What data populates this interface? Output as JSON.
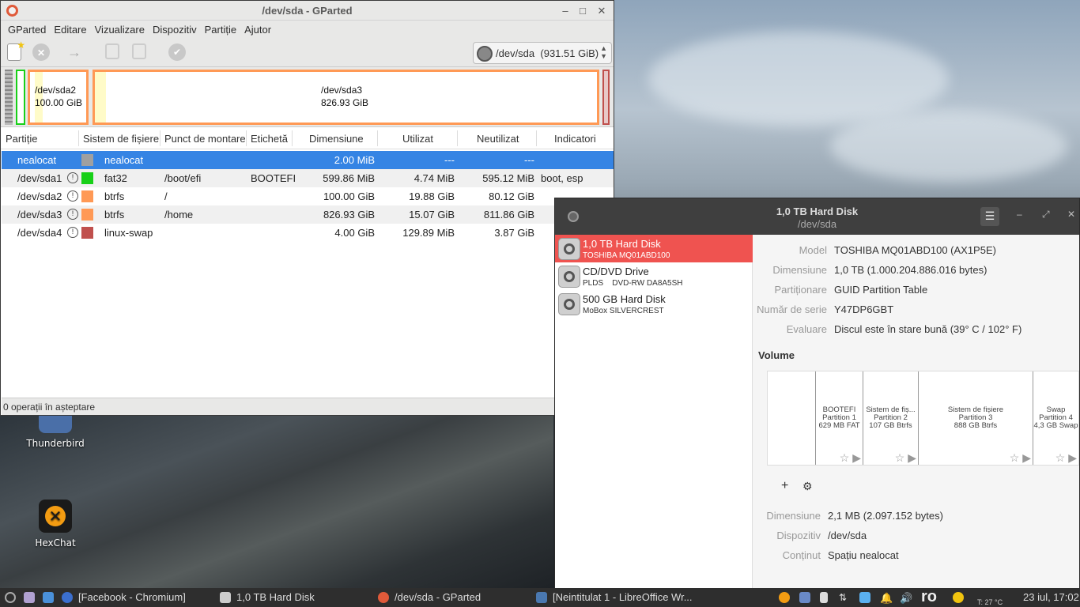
{
  "gparted": {
    "title": "/dev/sda - GParted",
    "menu": [
      "GParted",
      "Editare",
      "Vizualizare",
      "Dispozitiv",
      "Partiție",
      "Ajutor"
    ],
    "device_select": {
      "name": "/dev/sda",
      "size": "(931.51 GiB)"
    },
    "map": {
      "sda2_name": "/dev/sda2",
      "sda2_size": "100.00 GiB",
      "sda3_name": "/dev/sda3",
      "sda3_size": "826.93 GiB"
    },
    "columns": [
      "Partiție",
      "Sistem de fișiere",
      "Punct de montare",
      "Etichetă",
      "Dimensiune",
      "Utilizat",
      "Neutilizat",
      "Indicatori"
    ],
    "rows": [
      {
        "part": "nealocat",
        "fs": "nealocat",
        "mount": "",
        "label": "",
        "size": "2.00 MiB",
        "used": "---",
        "unused": "---",
        "flags": "",
        "color": "#a0a0a0"
      },
      {
        "part": "/dev/sda1",
        "fs": "fat32",
        "mount": "/boot/efi",
        "label": "BOOTEFI",
        "size": "599.86 MiB",
        "used": "4.74 MiB",
        "unused": "595.12 MiB",
        "flags": "boot, esp",
        "color": "#18d018"
      },
      {
        "part": "/dev/sda2",
        "fs": "btrfs",
        "mount": "/",
        "label": "",
        "size": "100.00 GiB",
        "used": "19.88 GiB",
        "unused": "80.12 GiB",
        "flags": "",
        "color": "#ff9955"
      },
      {
        "part": "/dev/sda3",
        "fs": "btrfs",
        "mount": "/home",
        "label": "",
        "size": "826.93 GiB",
        "used": "15.07 GiB",
        "unused": "811.86 GiB",
        "flags": "",
        "color": "#ff9955"
      },
      {
        "part": "/dev/sda4",
        "fs": "linux-swap",
        "mount": "",
        "label": "",
        "size": "4.00 GiB",
        "used": "129.89 MiB",
        "unused": "3.87 GiB",
        "flags": "",
        "color": "#c0504d"
      }
    ],
    "status": "0 operații în așteptare"
  },
  "disks": {
    "title": "1,0 TB Hard Disk",
    "subtitle": "/dev/sda",
    "devices": [
      {
        "name": "1,0 TB Hard Disk",
        "sub": "TOSHIBA MQ01ABD100"
      },
      {
        "name": "CD/DVD Drive",
        "sub": "PLDS    DVD-RW DA8A5SH"
      },
      {
        "name": "500 GB Hard Disk",
        "sub": "MoBox SILVERCREST"
      }
    ],
    "info": [
      {
        "k": "Model",
        "v": "TOSHIBA MQ01ABD100 (AX1P5E)"
      },
      {
        "k": "Dimensiune",
        "v": "1,0 TB (1.000.204.886.016 bytes)"
      },
      {
        "k": "Partiționare",
        "v": "GUID Partition Table"
      },
      {
        "k": "Număr de serie",
        "v": "Y47DP6GBT"
      },
      {
        "k": "Evaluare",
        "v": "Discul este în stare bună (39° C / 102° F)"
      }
    ],
    "volume_label": "Volume",
    "segments": [
      {
        "l1": "BOOTEFI",
        "l2": "Partition 1",
        "l3": "629 MB FAT"
      },
      {
        "l1": "Sistem de fiș...",
        "l2": "Partition 2",
        "l3": "107 GB Btrfs"
      },
      {
        "l1": "Sistem de fișiere",
        "l2": "Partition 3",
        "l3": "888 GB Btrfs"
      },
      {
        "l1": "Swap",
        "l2": "Partition 4",
        "l3": "4,3 GB Swap"
      }
    ],
    "vol_info": [
      {
        "k": "Dimensiune",
        "v": "2,1 MB (2.097.152 bytes)"
      },
      {
        "k": "Dispozitiv",
        "v": "/dev/sda"
      },
      {
        "k": "Conținut",
        "v": "Spațiu nealocat"
      }
    ]
  },
  "desktop": {
    "icons": [
      "Thunderbird",
      "HexChat"
    ]
  },
  "taskbar": {
    "windows": [
      "[Facebook - Chromium]",
      "1,0 TB Hard Disk",
      "/dev/sda - GParted",
      "[Neintitulat 1 - LibreOffice Wr..."
    ],
    "lang": "ro",
    "clock": "23 iul, 17:02",
    "weather": "T: 27 °C"
  }
}
